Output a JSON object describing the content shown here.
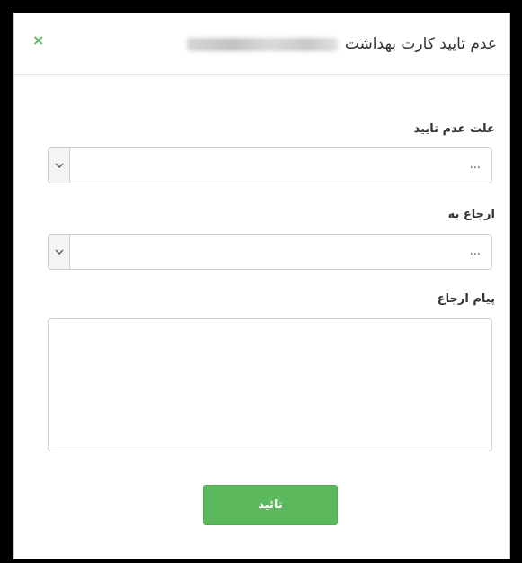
{
  "modal": {
    "title": "عدم تایید کارت بهداشت",
    "close_symbol": "×",
    "accent_color": "#5cb85c"
  },
  "form": {
    "reason_label": "علت عدم تایید",
    "reason_value": "...",
    "refer_label": "ارجاع به",
    "refer_value": "...",
    "message_label": "پیام ارجاع",
    "message_value": "",
    "submit_label": "تائید"
  },
  "icons": {
    "close": "close-icon",
    "select_arrow": "chevron-down-icon",
    "resize": "resize-grip-icon"
  }
}
